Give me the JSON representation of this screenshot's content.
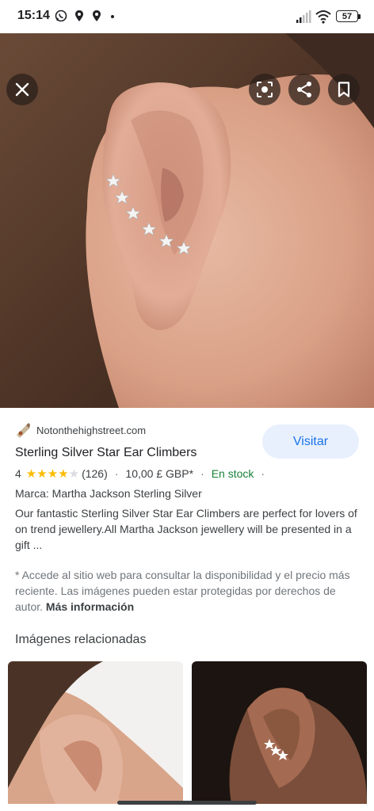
{
  "status_bar": {
    "time": "15:14",
    "battery": "57"
  },
  "image_viewer": {
    "close_icon": "close-icon",
    "lens_icon": "lens-icon",
    "share_icon": "share-icon",
    "bookmark_icon": "bookmark-icon"
  },
  "result": {
    "source": "Notonthehighstreet.com",
    "visit_label": "Visitar",
    "title": "Sterling Silver Star Ear Climbers",
    "rating": "4",
    "reviews": "(126)",
    "price": "10,00 £ GBP*",
    "availability": "En stock",
    "brand": "Marca: Martha Jackson Sterling Silver",
    "description": "Our fantastic Sterling Silver Star Ear Climbers are perfect for lovers of on trend jewellery.All Martha Jackson jewellery will be presented in a gift ...",
    "notice": "* Accede al sitio web para consultar la disponibilidad y el precio más reciente. Las imágenes pueden estar protegidas por derechos de autor.",
    "more_info": "Más información"
  },
  "related": {
    "heading": "Imágenes relacionadas"
  },
  "colors": {
    "accent": "#1a73e8",
    "stock": "#188038",
    "star": "#fbbc04"
  }
}
